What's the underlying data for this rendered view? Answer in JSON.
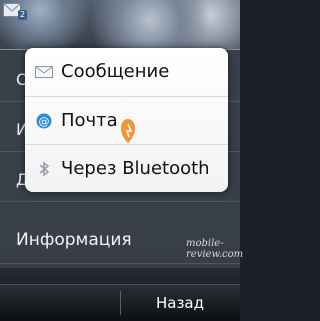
{
  "status_bar": {
    "message_count": "2",
    "message_icon": "envelope-icon"
  },
  "options_menu": {
    "items": [
      {
        "label": "О"
      },
      {
        "label": "И"
      },
      {
        "label": "Д"
      },
      {
        "label": "Информация"
      }
    ]
  },
  "submenu": {
    "items": [
      {
        "label": "Сообщение",
        "icon": "envelope-icon"
      },
      {
        "label": "Почта",
        "icon": "email-at-icon"
      },
      {
        "label": "Через Bluetooth",
        "icon": "bluetooth-icon"
      }
    ]
  },
  "softkeys": {
    "right_label": "Назад"
  },
  "watermark": "mobile-review.com",
  "colors": {
    "email_icon": "#2a8fd6",
    "tap_marker": "#f28a1e"
  }
}
